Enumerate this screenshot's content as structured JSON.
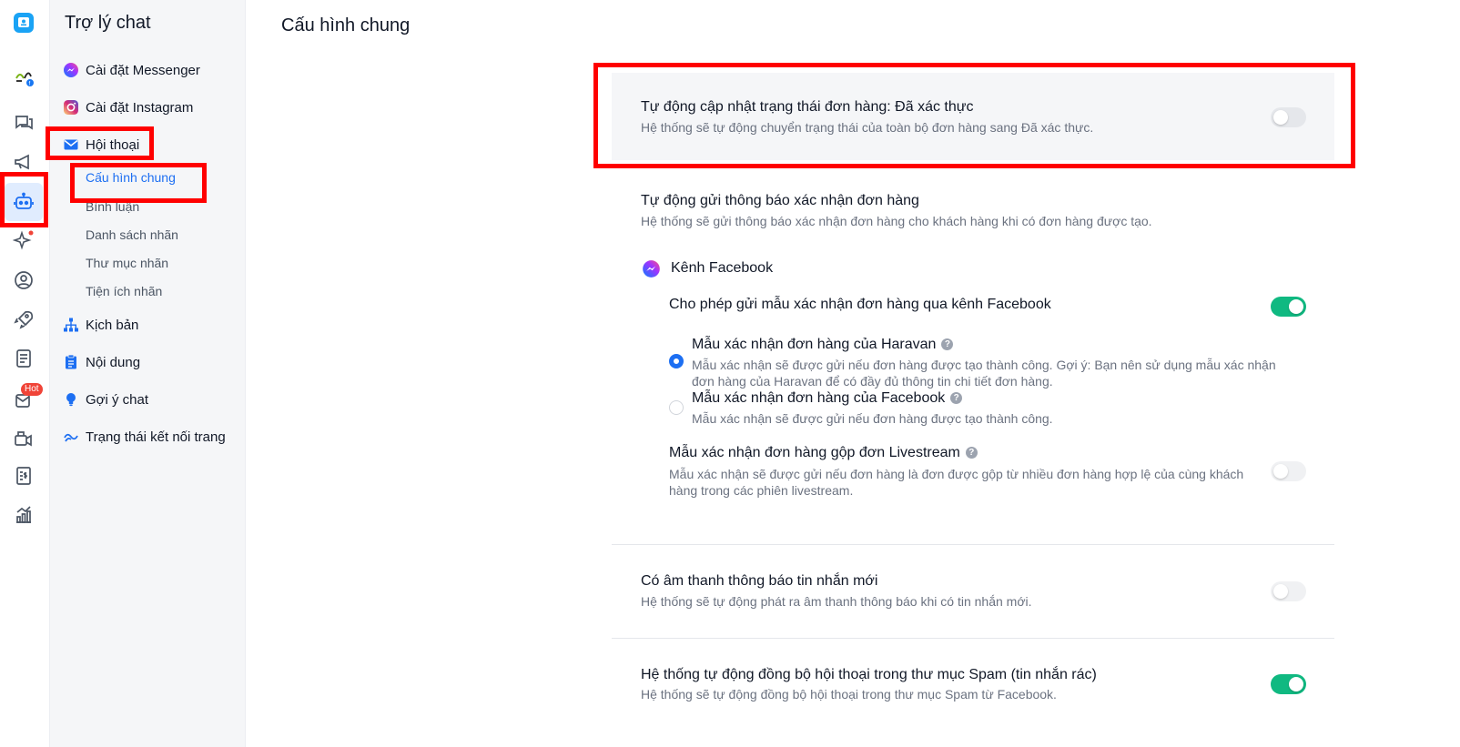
{
  "sidebar": {
    "title": "Trợ lý chat",
    "items": [
      {
        "label": "Cài đặt Messenger"
      },
      {
        "label": "Cài đặt Instagram"
      },
      {
        "label": "Hội thoại"
      },
      {
        "label": "Kịch bản"
      },
      {
        "label": "Nội dung"
      },
      {
        "label": "Gợi ý chat"
      },
      {
        "label": "Trạng thái kết nối trang"
      }
    ],
    "subitems": [
      {
        "label": "Cấu hình chung"
      },
      {
        "label": "Bình luận"
      },
      {
        "label": "Danh sách nhãn"
      },
      {
        "label": "Thư mục nhãn"
      },
      {
        "label": "Tiện ích nhãn"
      }
    ]
  },
  "rail": {
    "hot_badge": "Hot"
  },
  "main": {
    "title": "Cấu hình chung",
    "auto_update": {
      "title": "Tự động cập nhật trạng thái đơn hàng: Đã xác thực",
      "desc": "Hệ thống sẽ tự động chuyển trạng thái của toàn bộ đơn hàng sang Đã xác thực."
    },
    "auto_send": {
      "title": "Tự động gửi thông báo xác nhận đơn hàng",
      "desc": "Hệ thống sẽ gửi thông báo xác nhận đơn hàng cho khách hàng khi có đơn hàng được tạo."
    },
    "channel": {
      "label": "Kênh Facebook",
      "allow_label": "Cho phép gửi mẫu xác nhận đơn hàng qua kênh Facebook",
      "haravan_title": "Mẫu xác nhận đơn hàng của Haravan",
      "haravan_desc_1": "Mẫu xác nhận sẽ được gửi nếu đơn hàng được tạo thành công. Gợi ý: Bạn nên sử dụng mẫu xác nhận",
      "haravan_desc_2": "đơn hàng của Haravan để có đầy đủ thông tin chi tiết đơn hàng.",
      "facebook_title": "Mẫu xác nhận đơn hàng của Facebook",
      "facebook_desc": "Mẫu xác nhận sẽ được gửi nếu đơn hàng được tạo thành công.",
      "livestream_title": "Mẫu xác nhận đơn hàng gộp đơn Livestream",
      "livestream_desc_1": "Mẫu xác nhận sẽ được gửi nếu đơn hàng là đơn được gộp từ nhiều đơn hàng hợp lệ của cùng khách",
      "livestream_desc_2": "hàng trong các phiên livestream."
    },
    "sound": {
      "title": "Có âm thanh thông báo tin nhắn mới",
      "desc": "Hệ thống sẽ tự động phát ra âm thanh thông báo khi có tin nhắn mới."
    },
    "spam": {
      "title": "Hệ thống tự động đồng bộ hội thoại trong thư mục Spam (tin nhắn rác)",
      "desc": "Hệ thống sẽ tự động đồng bộ hội thoại trong thư mục Spam từ Facebook."
    },
    "help_glyph": "?"
  },
  "colors": {
    "accent": "#1d6ff2",
    "toggle_on": "#10b981",
    "highlight": "#ff0000"
  }
}
